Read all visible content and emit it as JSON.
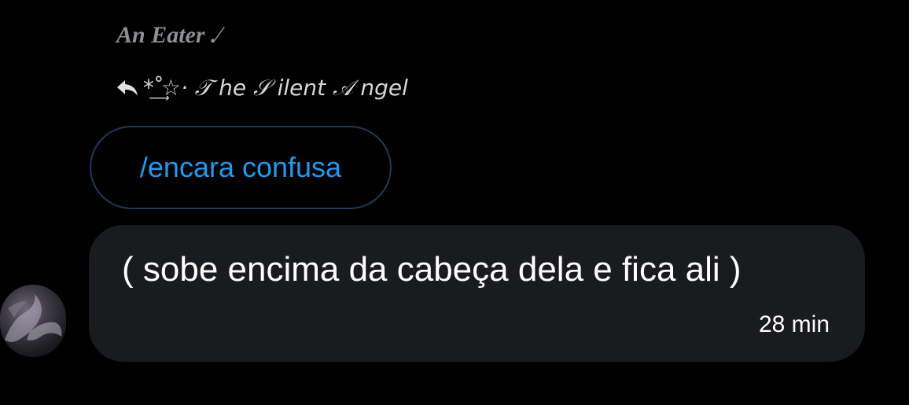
{
  "message_group": {
    "sender_name": "An Eater .⁄",
    "reply": {
      "icon": "reply-arrow-icon",
      "to_name": "* ̊͢☆· 𝒯 he 𝒮 ilent 𝒜 ngel"
    },
    "quoted_message": {
      "text": "/encara confusa"
    },
    "message": {
      "text": "( sobe encima da cabeça dela e fica ali )",
      "time": "28 min"
    }
  },
  "colors": {
    "background": "#000000",
    "bubble": "#1a1b1e",
    "quoted_border": "#1f3a5b",
    "link_blue": "#1d9bf0",
    "muted_text": "#8e8e93"
  }
}
